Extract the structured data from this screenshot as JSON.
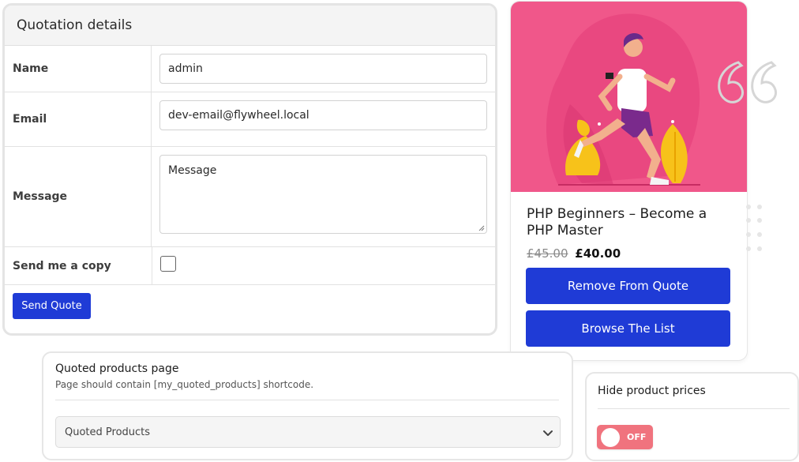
{
  "quotation": {
    "title": "Quotation details",
    "fields": [
      {
        "label": "Name",
        "value": "admin"
      },
      {
        "label": "Email",
        "value": "dev-email@flywheel.local"
      },
      {
        "label": "Message",
        "placeholder": "Message"
      },
      {
        "label": "Send me a copy",
        "checked": false
      }
    ],
    "send_button": "Send Quote"
  },
  "product": {
    "title": "PHP Beginners – Become a PHP Master",
    "old_price": "£45.00",
    "new_price": "£40.00",
    "remove_button": "Remove From Quote",
    "browse_button": "Browse The List",
    "image_bg": "#f0578a"
  },
  "quoted_page": {
    "title": "Quoted products page",
    "description": "Page should contain [my_quoted_products] shortcode.",
    "selected": "Quoted Products"
  },
  "hide_prices": {
    "title": "Hide product prices",
    "toggle_label": "OFF",
    "toggle_on": false
  },
  "colors": {
    "primary": "#1f3bd6",
    "toggle_off": "#f0737e"
  }
}
